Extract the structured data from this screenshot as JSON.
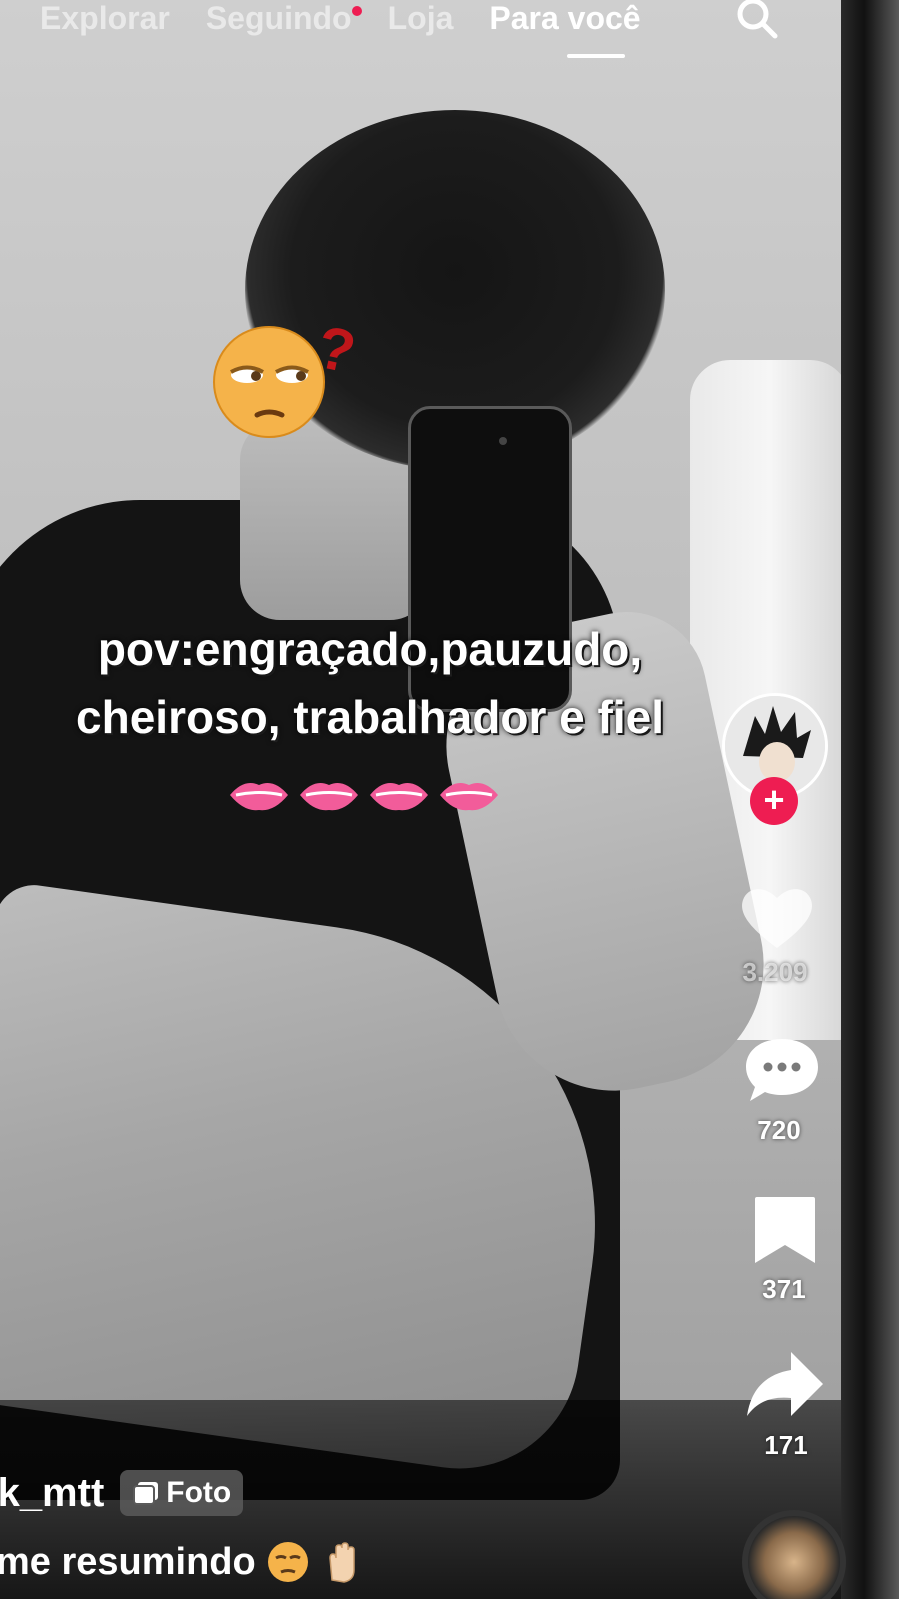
{
  "top_tabs": {
    "explore": "Explorar",
    "following": "Seguindo",
    "shop": "Loja",
    "for_you": "Para você",
    "active": "for_you"
  },
  "icons": {
    "search": "search-icon",
    "follow": "plus-icon",
    "like": "heart-icon",
    "comment": "comment-icon",
    "save": "bookmark-icon",
    "share": "share-icon",
    "media_type": "photo-icon"
  },
  "post": {
    "caption_line1": "pov:engraçado,pauzudo,",
    "caption_line2": "cheiroso, trabalhador e fiel",
    "author_username": "rk_mtt",
    "media_badge": "Foto",
    "description": "me resumindo"
  },
  "actions": {
    "follow_label": "+",
    "likes": "3.209",
    "comments": "720",
    "saves": "371",
    "shares": "171"
  },
  "colors": {
    "accent_pink": "#ee1d52",
    "text": "#ffffff",
    "lips": "#f25c9a"
  }
}
